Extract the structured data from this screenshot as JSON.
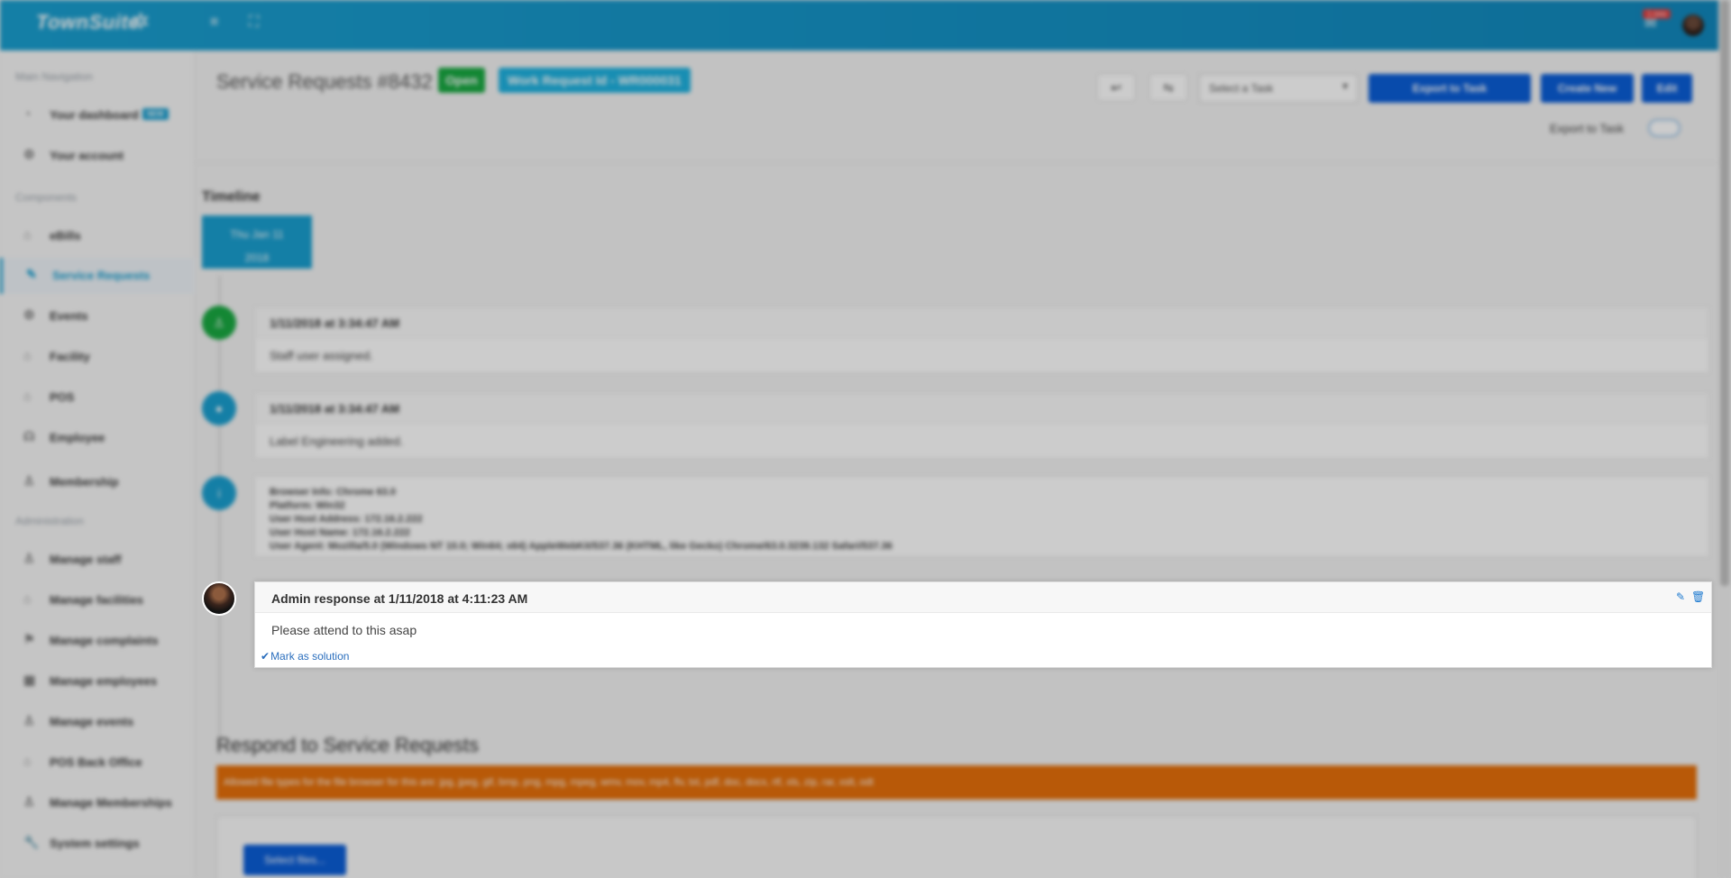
{
  "topbar": {
    "logo_text": "TownSuite",
    "notification_count": "1 new"
  },
  "sidebar": {
    "sections": [
      {
        "heading": "Main Navigation",
        "items": [
          {
            "label": "Your dashboard",
            "badge": "NEW",
            "icon": "dashboard-icon"
          },
          {
            "label": "Your account",
            "icon": "gear-icon"
          }
        ]
      },
      {
        "heading": "Components",
        "items": [
          {
            "label": "eBills",
            "icon": "bank-icon"
          },
          {
            "label": "Service Requests",
            "icon": "edit-icon",
            "active": true
          },
          {
            "label": "Events",
            "icon": "gear-icon"
          },
          {
            "label": "Facility",
            "icon": "home-icon"
          },
          {
            "label": "POS",
            "icon": "bank-icon"
          },
          {
            "label": "Employee",
            "icon": "headset-icon"
          },
          {
            "label": "Membership",
            "icon": "user-icon"
          }
        ]
      },
      {
        "heading": "Administration",
        "items": [
          {
            "label": "Manage staff",
            "icon": "user-icon"
          },
          {
            "label": "Manage facilities",
            "icon": "home-icon"
          },
          {
            "label": "Manage complaints",
            "icon": "flag-icon"
          },
          {
            "label": "Manage employees",
            "icon": "calendar-icon"
          },
          {
            "label": "Manage events",
            "icon": "user-icon"
          },
          {
            "label": "POS Back Office",
            "icon": "bank-icon"
          },
          {
            "label": "Manage Memberships",
            "icon": "user-icon"
          },
          {
            "label": "System settings",
            "icon": "wrench-icon"
          }
        ]
      }
    ]
  },
  "header": {
    "title": "Service Requests #8432",
    "status": "Open",
    "work_request": "Work Request Id - WR000031",
    "select_task_placeholder": "Select a Task",
    "export_button": "Export to Task",
    "create_button": "Create New",
    "edit_button": "Edit",
    "export_toggle_label": "Export to Task"
  },
  "timeline": {
    "heading": "Timeline",
    "date_line1": "Thu Jan 11",
    "date_line2": "2018",
    "entries": [
      {
        "header": "1/11/2018 at 3:34:47 AM",
        "body": "Staff user assigned."
      },
      {
        "header": "1/11/2018 at 3:34:47 AM",
        "body": "Label Engineering added."
      },
      {
        "lines": [
          "Browser Info: Chrome 63.0",
          "Platform: Win32",
          "User Host Address: 172.16.2.222",
          "User Host Name: 172.16.2.222",
          "User Agent: Mozilla/5.0 (Windows NT 10.0; Win64; x64) AppleWebKit/537.36 (KHTML, like Gecko) Chrome/63.0.3239.132 Safari/537.36"
        ]
      }
    ],
    "admin_response": {
      "header": "Admin response at 1/11/2018 at 4:11:23 AM",
      "body": "Please attend to this asap",
      "mark_solution": "Mark as solution"
    }
  },
  "respond": {
    "heading": "Respond to Service Requests",
    "alert": "Allowed file types for the file browser for this are: jpg, jpeg, gif, bmp, png, mpg, mpeg, wmv, mov, mp4, flv, txt, pdf, doc, docx, rtf, xls, zip, rar, xslt, odt",
    "select_files": "Select files..."
  },
  "colors": {
    "brand": "#1a9fd0",
    "primary_button": "#0b5ed8",
    "status_open": "#19a942",
    "alert": "#e6700a",
    "link": "#2a6ebd"
  }
}
